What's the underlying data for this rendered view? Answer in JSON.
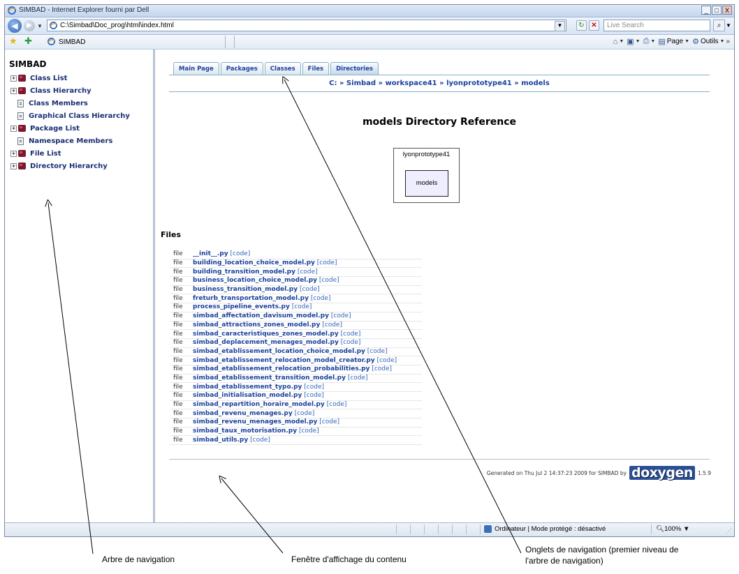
{
  "window": {
    "title": "SIMBAD - Internet Explorer fourni par Dell",
    "min_label": "_",
    "max_label": "□",
    "close_label": "X"
  },
  "addressbar": {
    "url": "C:\\Simbad\\Doc_prog\\html\\index.html",
    "search_placeholder": "Live Search",
    "back_icon": "back-arrow-icon",
    "forward_icon": "forward-arrow-icon"
  },
  "favbar": {
    "tab_label": "SIMBAD",
    "commands": [
      {
        "icon": "home-icon",
        "label": ""
      },
      {
        "icon": "feeds-icon",
        "label": ""
      },
      {
        "icon": "print-icon",
        "label": ""
      },
      {
        "icon": "page-icon",
        "label": "Page"
      },
      {
        "icon": "tools-icon",
        "label": "Outils"
      }
    ]
  },
  "sidebar": {
    "title": "SIMBAD",
    "items": [
      {
        "label": "Class List",
        "kind": "book",
        "expandable": true
      },
      {
        "label": "Class Hierarchy",
        "kind": "book",
        "expandable": true
      },
      {
        "label": "Class Members",
        "kind": "doc",
        "expandable": false
      },
      {
        "label": "Graphical Class Hierarchy",
        "kind": "doc",
        "expandable": false
      },
      {
        "label": "Package List",
        "kind": "book",
        "expandable": true
      },
      {
        "label": "Namespace Members",
        "kind": "doc",
        "expandable": false
      },
      {
        "label": "File List",
        "kind": "book",
        "expandable": true
      },
      {
        "label": "Directory Hierarchy",
        "kind": "book",
        "expandable": true
      }
    ]
  },
  "content": {
    "tabs": [
      "Main Page",
      "Packages",
      "Classes",
      "Files",
      "Directories"
    ],
    "breadcrumb": "C: » Simbad » workspace41 » lyonprototype41 » models",
    "heading": "models Directory Reference",
    "dir_graph": {
      "outer": "lyonprototype41",
      "inner": "models"
    },
    "files_heading": "Files",
    "file_kind": "file",
    "code_label": "[code]",
    "files": [
      "__init__.py",
      "building_location_choice_model.py",
      "building_transition_model.py",
      "business_location_choice_model.py",
      "business_transition_model.py",
      "freturb_transportation_model.py",
      "process_pipeline_events.py",
      "simbad_affectation_davisum_model.py",
      "simbad_attractions_zones_model.py",
      "simbad_caracteristiques_zones_model.py",
      "simbad_deplacement_menages_model.py",
      "simbad_etablissement_location_choice_model.py",
      "simbad_etablissement_relocation_model_creator.py",
      "simbad_etablissement_relocation_probabilities.py",
      "simbad_etablissement_transition_model.py",
      "simbad_etablissement_typo.py",
      "simbad_initialisation_model.py",
      "simbad_repartition_horaire_model.py",
      "simbad_revenu_menages.py",
      "simbad_revenu_menages_model.py",
      "simbad_taux_motorisation.py",
      "simbad_utils.py"
    ],
    "generated_text": "Generated on Thu Jul 2 14:37:23 2009 for SIMBAD by",
    "doxygen_logo": "doxygen",
    "doxygen_version": "1.5.9"
  },
  "statusbar": {
    "zone_text": "Ordinateur | Mode protégé : désactivé",
    "zoom": "100%"
  },
  "callouts": {
    "nav_tree": "Arbre de navigation",
    "content_window": "Fenêtre d'affichage du contenu",
    "nav_tabs_line1": "Onglets de navigation (premier niveau de",
    "nav_tabs_line2": "l'arbre de navigation)"
  }
}
